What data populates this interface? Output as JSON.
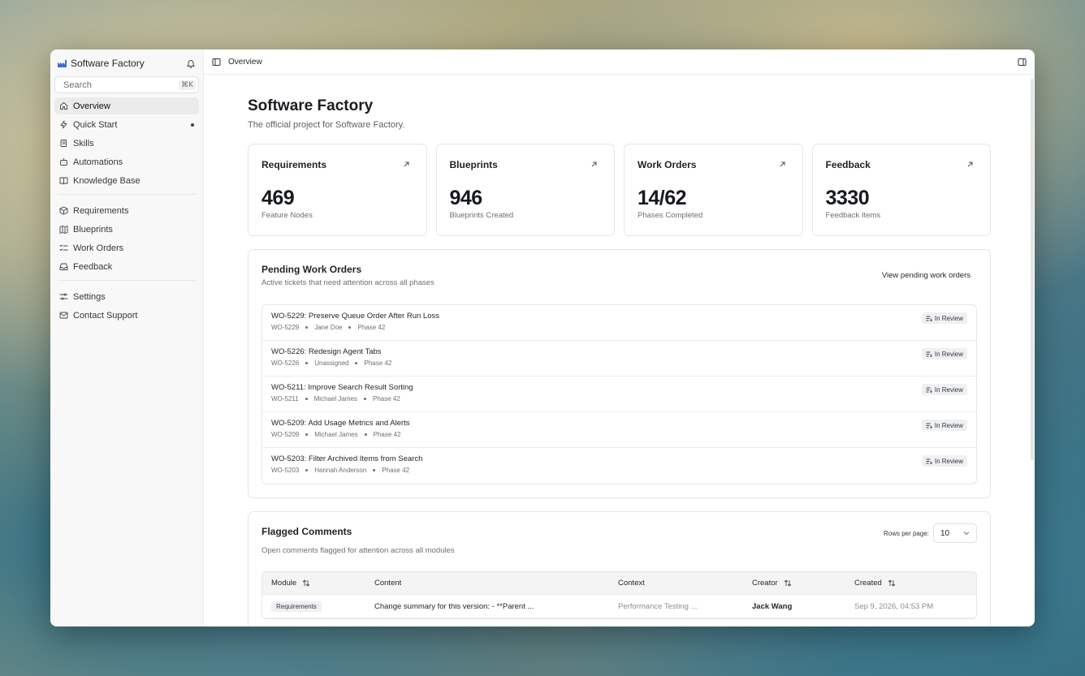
{
  "sidebar": {
    "brand": "Software Factory",
    "search": {
      "placeholder": "Search",
      "shortcut": "⌘K"
    },
    "groups": [
      [
        {
          "label": "Overview",
          "icon": "home-icon",
          "active": true
        },
        {
          "label": "Quick Start",
          "icon": "bolt-icon",
          "dot": true
        },
        {
          "label": "Skills",
          "icon": "scroll-icon"
        },
        {
          "label": "Automations",
          "icon": "bot-icon"
        },
        {
          "label": "Knowledge Base",
          "icon": "book-icon"
        }
      ],
      [
        {
          "label": "Requirements",
          "icon": "box-icon"
        },
        {
          "label": "Blueprints",
          "icon": "map-icon"
        },
        {
          "label": "Work Orders",
          "icon": "list-checks-icon"
        },
        {
          "label": "Feedback",
          "icon": "inbox-icon"
        }
      ],
      [
        {
          "label": "Settings",
          "icon": "sliders-icon"
        },
        {
          "label": "Contact Support",
          "icon": "mail-icon"
        }
      ]
    ]
  },
  "topbar": {
    "breadcrumb": "Overview"
  },
  "page": {
    "title": "Software Factory",
    "subtitle": "The official project for Software Factory."
  },
  "stats": [
    {
      "title": "Requirements",
      "value": "469",
      "label": "Feature Nodes"
    },
    {
      "title": "Blueprints",
      "value": "946",
      "label": "Blueprints Created"
    },
    {
      "title": "Work Orders",
      "value": "14/62",
      "label": "Phases Completed"
    },
    {
      "title": "Feedback",
      "value": "3330",
      "label": "Feedback Items"
    }
  ],
  "pending": {
    "title": "Pending Work Orders",
    "subtitle": "Active tickets that need attention across all phases",
    "link": "View pending work orders",
    "items": [
      {
        "title": "WO-5229: Preserve Queue Order After Run Loss",
        "id": "WO-5229",
        "assignee": "Jane Doe",
        "phase": "Phase 42",
        "status": "In Review"
      },
      {
        "title": "WO-5226: Redesign Agent Tabs",
        "id": "WO-5226",
        "assignee": "Unassigned",
        "phase": "Phase 42",
        "status": "In Review"
      },
      {
        "title": "WO-5211: Improve Search Result Sorting",
        "id": "WO-5211",
        "assignee": "Michael James",
        "phase": "Phase 42",
        "status": "In Review"
      },
      {
        "title": "WO-5209: Add Usage Metrics and Alerts",
        "id": "WO-5209",
        "assignee": "Michael James",
        "phase": "Phase 42",
        "status": "In Review"
      },
      {
        "title": "WO-5203: Filter Archived Items from Search",
        "id": "WO-5203",
        "assignee": "Hannah Anderson",
        "phase": "Phase 42",
        "status": "In Review"
      }
    ]
  },
  "flagged": {
    "title": "Flagged Comments",
    "subtitle": "Open comments flagged for attention across all modules",
    "rows_label": "Rows per page:",
    "rows_value": "10",
    "columns": [
      "Module",
      "Content",
      "Context",
      "Creator",
      "Created"
    ],
    "rows": [
      {
        "module": "Requirements",
        "content": "Change summary for this version: - **Parent ...",
        "context": "Performance Testing ...",
        "creator": "Jack Wang",
        "created": "Sep 9, 2026, 04:53 PM"
      }
    ]
  }
}
